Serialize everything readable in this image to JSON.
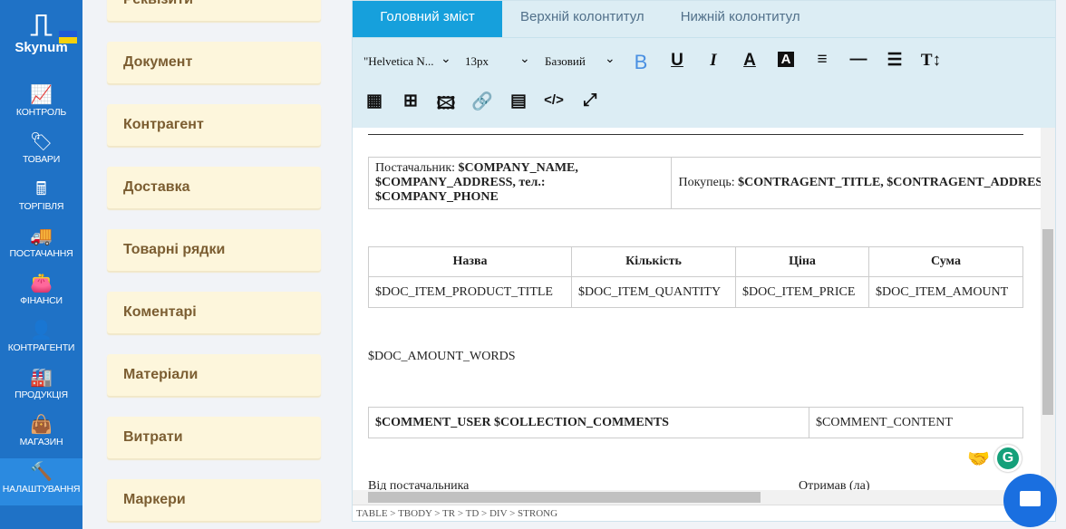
{
  "brand": {
    "name": "Skynum"
  },
  "nav": [
    {
      "label": "Контроль",
      "icon": "📈"
    },
    {
      "label": "Товари",
      "icon": "🏷"
    },
    {
      "label": "Торгівля",
      "icon": "🖩"
    },
    {
      "label": "Постачання",
      "icon": "🚚"
    },
    {
      "label": "Фінанси",
      "icon": "👛"
    },
    {
      "label": "Контрагенти",
      "icon": "👤"
    },
    {
      "label": "Продукція",
      "icon": "🏭"
    },
    {
      "label": "Магазин",
      "icon": "👜"
    },
    {
      "label": "Налаштування",
      "icon": "🔨"
    }
  ],
  "sections": [
    "Реквізити",
    "Документ",
    "Контрагент",
    "Доставка",
    "Товарні рядки",
    "Коментарі",
    "Матеріали",
    "Витрати",
    "Маркери"
  ],
  "editor": {
    "tabs": [
      "Головний зміст",
      "Верхній колонтитул",
      "Нижній колонтитул"
    ],
    "font": "\"Helvetica N...",
    "size": "13px",
    "style": "Базовий",
    "content": {
      "supplier_label": "Постачальник: ",
      "supplier_value": "$COMPANY_NAME, $COMPANY_ADDRESS, тел.: $COMPANY_PHONE",
      "buyer_label": "Покупець: ",
      "buyer_value": "$CONTRAGENT_TITLE, $CONTRAGENT_ADDRESS",
      "items_headers": [
        "Назва",
        "Кількість",
        "Ціна",
        "Сума"
      ],
      "items_row": [
        "$DOC_ITEM_PRODUCT_TITLE",
        "$DOC_ITEM_QUANTITY",
        "$DOC_ITEM_PRICE",
        "$DOC_ITEM_AMOUNT"
      ],
      "amount_words": "$DOC_AMOUNT_WORDS",
      "comment_left": "$COMMENT_USER $COLLECTION_COMMENTS",
      "comment_right": "$COMMENT_CONTENT",
      "from_supplier": "Від постачальника",
      "received": "Отримав (ла)"
    },
    "status_path": "TABLE > TBODY > TR > TD > DIV > STRONG"
  }
}
